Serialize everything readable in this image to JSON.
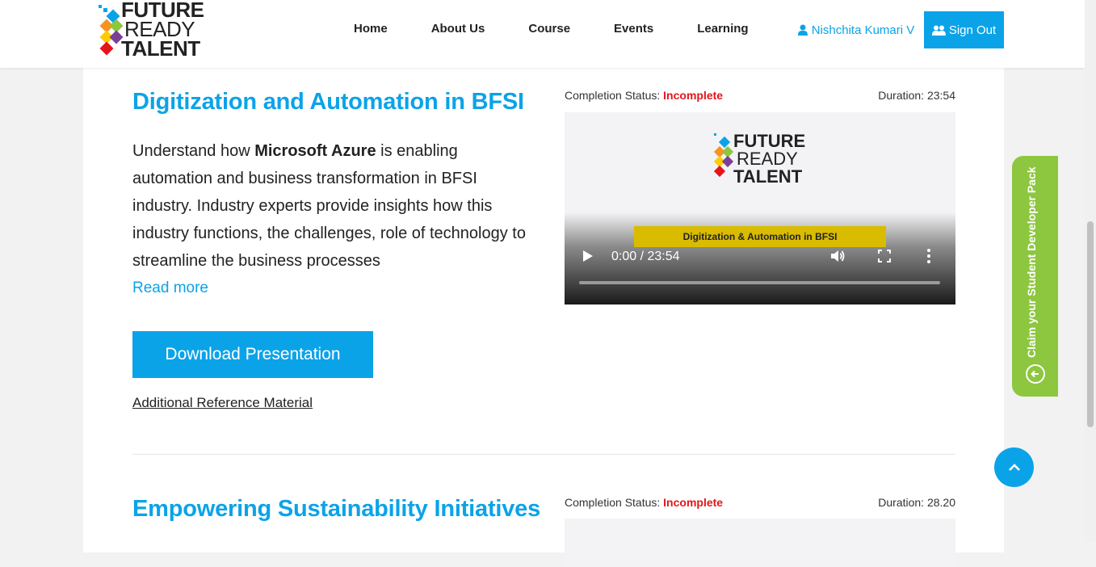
{
  "brand": {
    "line1": "FUTURE",
    "line2": "READY",
    "line3": "TALENT"
  },
  "nav": {
    "items": [
      "Home",
      "About Us",
      "Course",
      "Events",
      "Learning"
    ]
  },
  "user": {
    "name": "Nishchita Kumari V",
    "signout_label": "Sign Out"
  },
  "course1": {
    "title": "Digitization and Automation in BFSI",
    "desc_prefix": "Understand how ",
    "desc_bold": "Microsoft Azure",
    "desc_suffix": " is enabling automation and business transformation in BFSI industry. Industry experts provide insights how this industry functions, the challenges, role of technology to streamline the business processes",
    "read_more": "Read more",
    "download_label": "Download Presentation",
    "additional_ref": "Additional Reference Material",
    "status_label": "Completion Status: ",
    "status_value": "Incomplete",
    "duration": "Duration: 23:54",
    "video": {
      "banner": "Digitization & Automation in BFSI",
      "time": "0:00 / 23:54",
      "progress": 0
    }
  },
  "course2": {
    "title": "Empowering Sustainability Initiatives",
    "status_label": "Completion Status: ",
    "status_value": "Incomplete",
    "duration": "Duration: 28.20"
  },
  "sidetab": {
    "label": "Claim your Student Developer Pack"
  },
  "colors": {
    "accent": "#0ba3e8",
    "incomplete": "#e3161b",
    "sidetab": "#8dc63f",
    "banner": "#d9bc00"
  }
}
